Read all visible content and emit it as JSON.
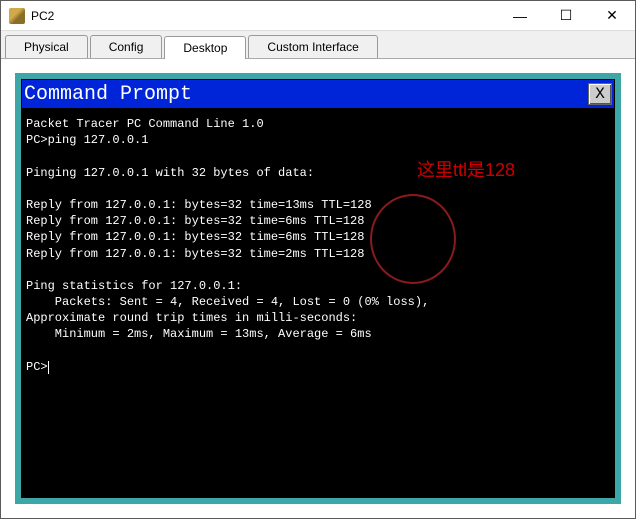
{
  "window": {
    "title": "PC2",
    "controls": {
      "min": "—",
      "max": "☐",
      "close": "✕"
    }
  },
  "tabs": {
    "items": [
      {
        "label": "Physical"
      },
      {
        "label": "Config"
      },
      {
        "label": "Desktop"
      },
      {
        "label": "Custom Interface"
      }
    ],
    "active_index": 2
  },
  "cmd": {
    "title": "Command Prompt",
    "close": "X",
    "lines": {
      "l0": "Packet Tracer PC Command Line 1.0",
      "l1": "PC>ping 127.0.0.1",
      "l2": "",
      "l3": "Pinging 127.0.0.1 with 32 bytes of data:",
      "l4": "",
      "l5": "Reply from 127.0.0.1: bytes=32 time=13ms TTL=128",
      "l6": "Reply from 127.0.0.1: bytes=32 time=6ms TTL=128",
      "l7": "Reply from 127.0.0.1: bytes=32 time=6ms TTL=128",
      "l8": "Reply from 127.0.0.1: bytes=32 time=2ms TTL=128",
      "l9": "",
      "l10": "Ping statistics for 127.0.0.1:",
      "l11": "    Packets: Sent = 4, Received = 4, Lost = 0 (0% loss),",
      "l12": "Approximate round trip times in milli-seconds:",
      "l13": "    Minimum = 2ms, Maximum = 13ms, Average = 6ms",
      "l14": "",
      "l15": "PC>"
    }
  },
  "annotation": {
    "text": "这里ttl是128"
  }
}
